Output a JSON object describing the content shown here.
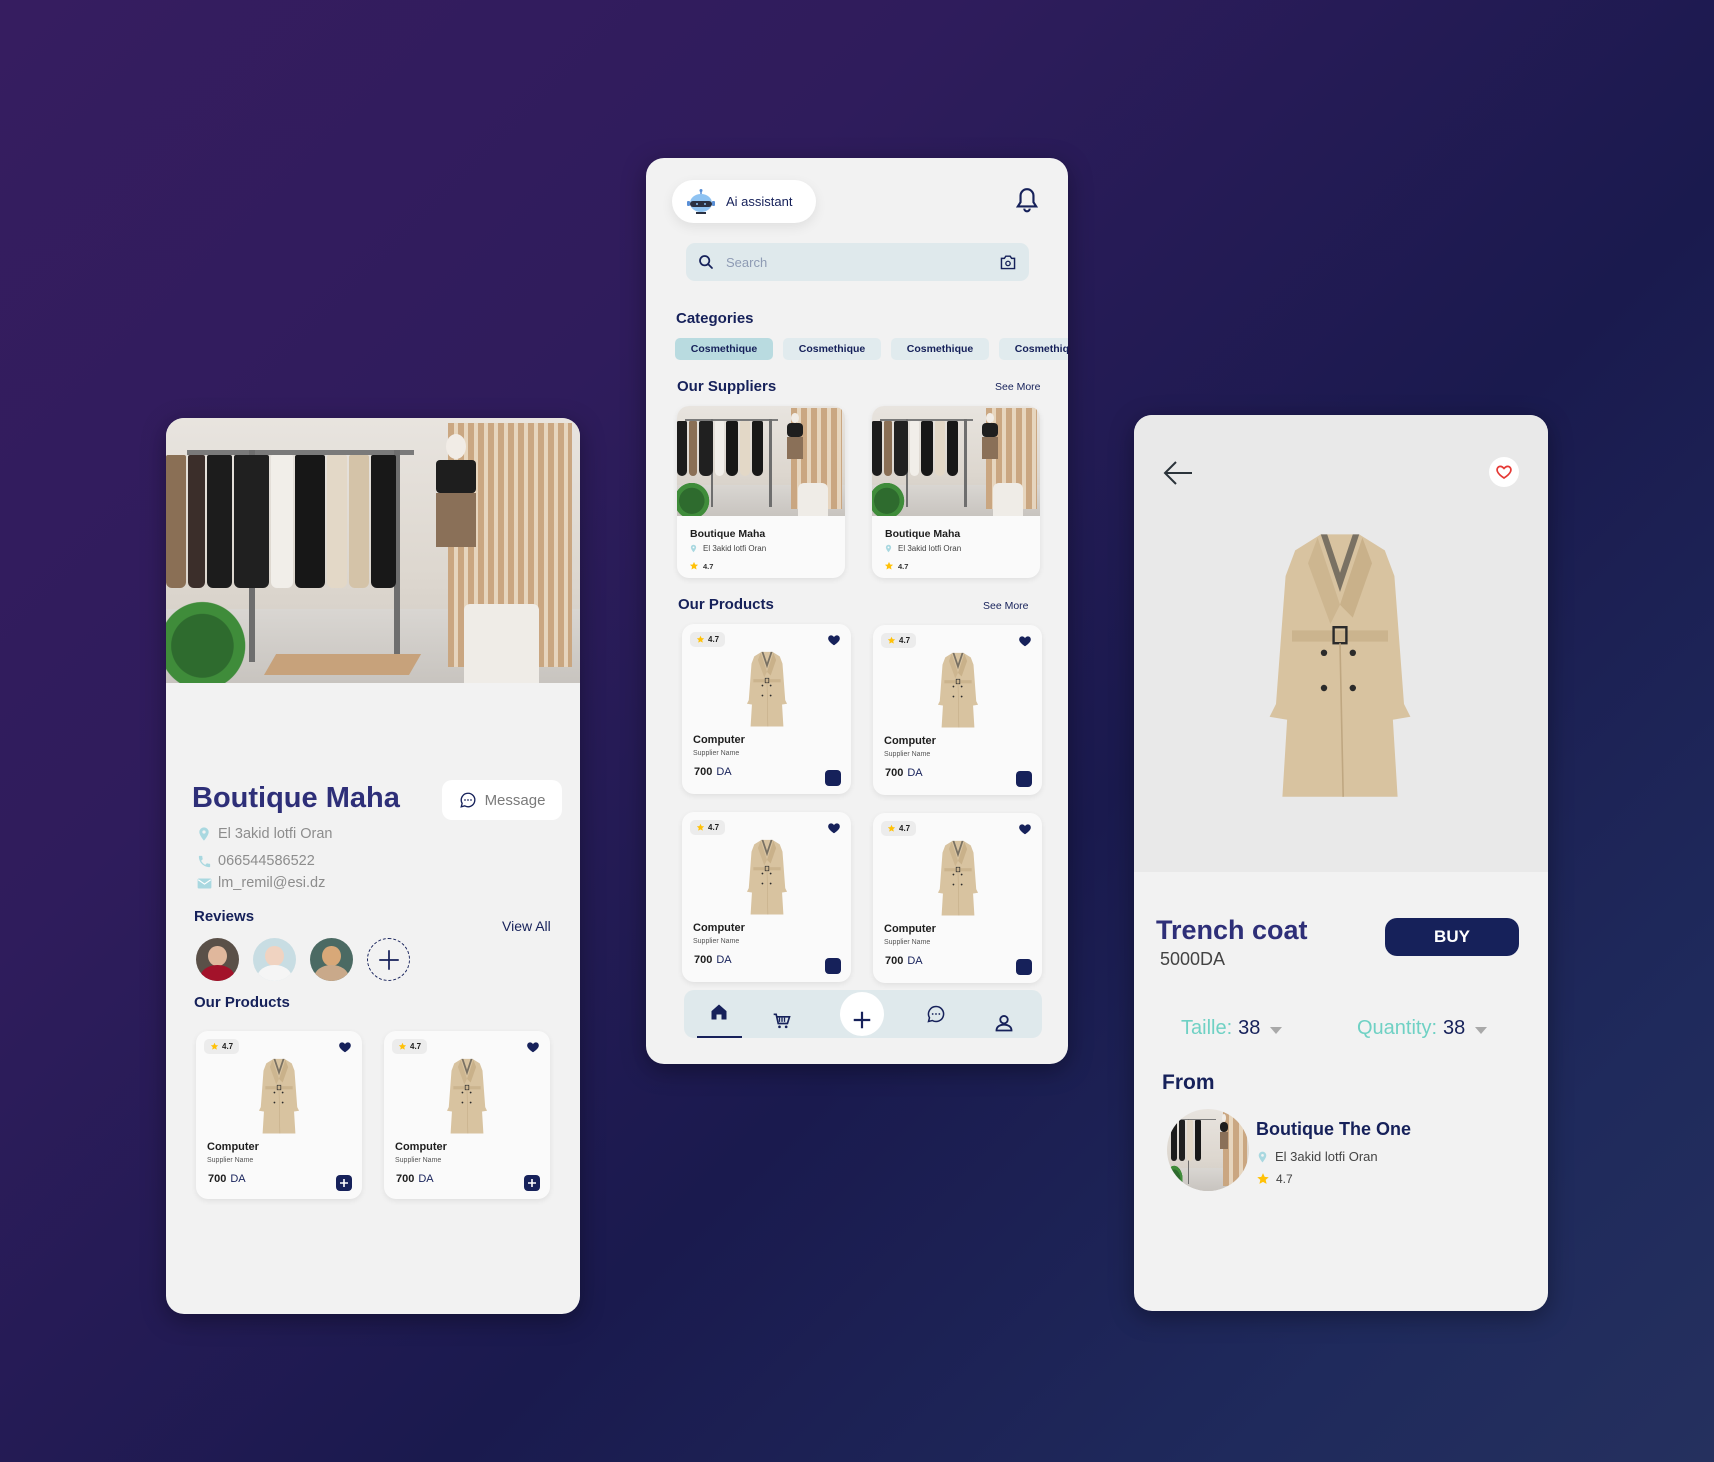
{
  "colors": {
    "navy": "#16215a",
    "title_purple": "#2e2f78",
    "teal_label": "#6fd1c4",
    "chip_active": "#b9dbe0",
    "chip": "#e1ebee",
    "favorite_red": "#e53935",
    "star_yellow": "#ffc107"
  },
  "store_profile": {
    "name": "Boutique Maha",
    "message_button": "Message",
    "location": "El 3akid lotfi Oran",
    "phone": "066544586522",
    "email": "lm_remil@esi.dz",
    "reviews_title": "Reviews",
    "view_all": "View All",
    "reviewers": [
      "reviewer-1",
      "reviewer-2",
      "reviewer-3"
    ],
    "products_title": "Our Products",
    "products": [
      {
        "rating": "4.7",
        "name": "Computer",
        "supplier": "Supplier Name",
        "price": "700",
        "currency": "DA"
      },
      {
        "rating": "4.7",
        "name": "Computer",
        "supplier": "Supplier Name",
        "price": "700",
        "currency": "DA"
      }
    ]
  },
  "home": {
    "ai_assistant": "Ai assistant",
    "search_placeholder": "Search",
    "categories_title": "Categories",
    "categories": [
      "Cosmethique",
      "Cosmethique",
      "Cosmethique",
      "Cosmethique"
    ],
    "suppliers_title": "Our Suppliers",
    "suppliers_see_more": "See More",
    "suppliers": [
      {
        "name": "Boutique Maha",
        "location": "El 3akid lotfi Oran",
        "rating": "4.7"
      },
      {
        "name": "Boutique Maha",
        "location": "El 3akid lotfi Oran",
        "rating": "4.7"
      }
    ],
    "products_title": "Our Products",
    "products_see_more": "See More",
    "products": [
      {
        "rating": "4.7",
        "name": "Computer",
        "supplier": "Supplier Name",
        "price": "700",
        "currency": "DA"
      },
      {
        "rating": "4.7",
        "name": "Computer",
        "supplier": "Supplier Name",
        "price": "700",
        "currency": "DA"
      },
      {
        "rating": "4.7",
        "name": "Computer",
        "supplier": "Supplier Name",
        "price": "700",
        "currency": "DA"
      },
      {
        "rating": "4.7",
        "name": "Computer",
        "supplier": "Supplier Name",
        "price": "700",
        "currency": "DA"
      }
    ],
    "tabbar": [
      "home-icon",
      "cart-icon",
      "plus-icon",
      "chat-icon",
      "user-icon"
    ],
    "active_tab": "home"
  },
  "product_detail": {
    "title": "Trench coat",
    "price": "5000DA",
    "buy_button": "BUY",
    "size_label": "Taille:",
    "size_value": "38",
    "quantity_label": "Quantity:",
    "quantity_value": "38",
    "from_title": "From",
    "seller": {
      "name": "Boutique The One",
      "location": "El 3akid lotfi Oran",
      "rating": "4.7"
    }
  }
}
